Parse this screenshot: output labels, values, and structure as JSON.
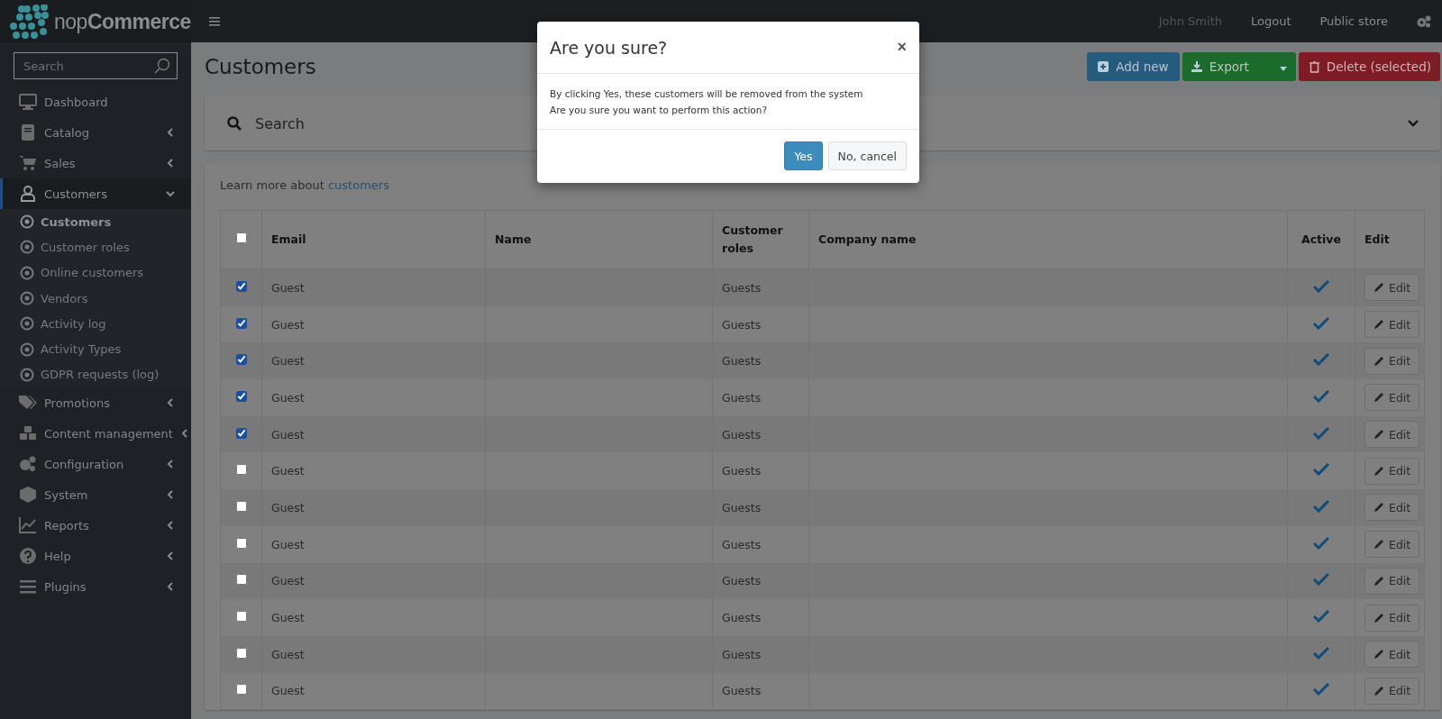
{
  "logo": {
    "text_light": "nop",
    "text_bold": "Commerce"
  },
  "topbar": {
    "user": "John Smith",
    "links": [
      "Logout",
      "Public store"
    ]
  },
  "sidebar": {
    "search": {
      "placeholder": "Search"
    },
    "items": [
      {
        "label": "Dashboard",
        "kind": "link"
      },
      {
        "label": "Catalog",
        "kind": "menu",
        "expanded": false
      },
      {
        "label": "Sales",
        "kind": "menu",
        "expanded": false
      },
      {
        "label": "Customers",
        "kind": "menu",
        "expanded": true,
        "children": [
          {
            "label": "Customers",
            "selected": true
          },
          {
            "label": "Customer roles",
            "selected": false
          },
          {
            "label": "Online customers",
            "selected": false
          },
          {
            "label": "Vendors",
            "selected": false
          },
          {
            "label": "Activity log",
            "selected": false
          },
          {
            "label": "Activity Types",
            "selected": false
          },
          {
            "label": "GDPR requests (log)",
            "selected": false
          }
        ]
      },
      {
        "label": "Promotions",
        "kind": "menu",
        "expanded": false
      },
      {
        "label": "Content management",
        "kind": "menu",
        "expanded": false
      },
      {
        "label": "Configuration",
        "kind": "menu",
        "expanded": false
      },
      {
        "label": "System",
        "kind": "menu",
        "expanded": false
      },
      {
        "label": "Reports",
        "kind": "menu",
        "expanded": false
      },
      {
        "label": "Help",
        "kind": "menu",
        "expanded": false
      },
      {
        "label": "Plugins",
        "kind": "menu",
        "expanded": false
      }
    ]
  },
  "page": {
    "title": "Customers",
    "buttons": [
      {
        "label": "Add new",
        "kind": "add"
      },
      {
        "label": "Export",
        "kind": "export"
      },
      {
        "label": "Delete (selected)",
        "kind": "delete"
      }
    ]
  },
  "search_panel": {
    "title": "Search",
    "expanded": false
  },
  "learn_more": {
    "text": "Learn more about",
    "link": "customers"
  },
  "table": {
    "select_all": {
      "checked": false
    },
    "columns": [
      "Email",
      "Name",
      "Customer roles",
      "Company name",
      "Active",
      "Edit"
    ],
    "rows": [
      {
        "checked": true,
        "email": "Guest",
        "roles": "Guests",
        "active": true,
        "action": "Edit"
      },
      {
        "checked": true,
        "email": "Guest",
        "roles": "Guests",
        "active": true,
        "action": "Edit"
      },
      {
        "checked": true,
        "email": "Guest",
        "roles": "Guests",
        "active": true,
        "action": "Edit"
      },
      {
        "checked": true,
        "email": "Guest",
        "roles": "Guests",
        "active": true,
        "action": "Edit"
      },
      {
        "checked": true,
        "email": "Guest",
        "roles": "Guests",
        "active": true,
        "action": "Edit"
      },
      {
        "checked": false,
        "email": "Guest",
        "roles": "Guests",
        "active": true,
        "action": "Edit"
      },
      {
        "checked": false,
        "email": "Guest",
        "roles": "Guests",
        "active": true,
        "action": "Edit"
      },
      {
        "checked": false,
        "email": "Guest",
        "roles": "Guests",
        "active": true,
        "action": "Edit"
      },
      {
        "checked": false,
        "email": "Guest",
        "roles": "Guests",
        "active": true,
        "action": "Edit"
      },
      {
        "checked": false,
        "email": "Guest",
        "roles": "Guests",
        "active": true,
        "action": "Edit"
      },
      {
        "checked": false,
        "email": "Guest",
        "roles": "Guests",
        "active": true,
        "action": "Edit"
      },
      {
        "checked": false,
        "email": "Guest",
        "roles": "Guests",
        "active": true,
        "action": "Edit"
      }
    ]
  },
  "dialog": {
    "title": "Are you sure?",
    "close": "×",
    "lines": [
      "By clicking Yes, these customers will be removed from the system",
      "Are you sure you want to perform this action?"
    ],
    "buttons": [
      {
        "label": "Yes",
        "kind": "primary"
      },
      {
        "label": "No, cancel",
        "kind": "secondary"
      }
    ]
  }
}
